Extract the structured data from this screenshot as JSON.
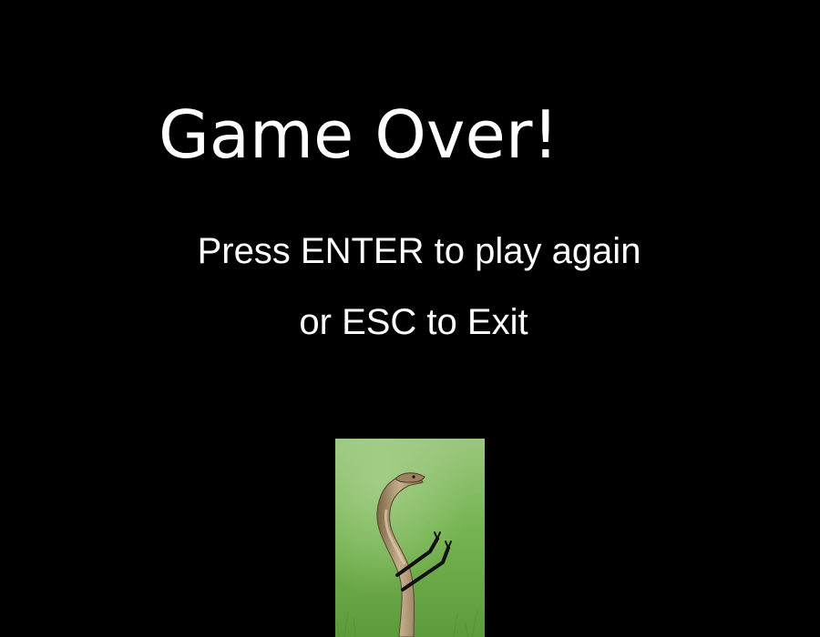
{
  "game_over": {
    "title": "Game Over!",
    "instruction_line1": "Press ENTER to play again",
    "instruction_line2": "or ESC to Exit"
  },
  "image": {
    "subject": "cobra-with-arms-icon"
  },
  "colors": {
    "background": "#000000",
    "text": "#ffffff",
    "grass": "#6fae4a",
    "snake_body": "#b39a74"
  }
}
